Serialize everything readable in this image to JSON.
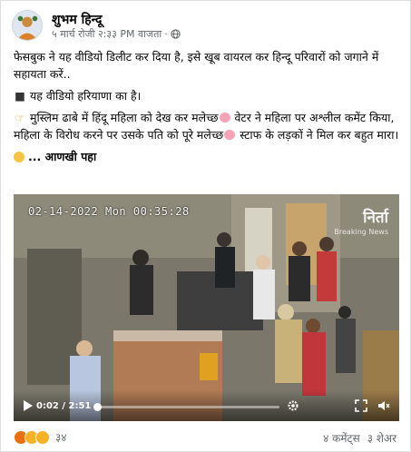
{
  "header": {
    "author": "शुभम हिन्दू",
    "timestamp": "५ मार्च रोजी २:३३ PM वाजता",
    "separator": "·",
    "privacy_icon": "globe-icon"
  },
  "post": {
    "line1": "फेसबुक ने यह वीडियो डिलीट कर दिया है, इसे खूब वायरल कर हिन्दू परिवारों को जगाने में सहायता करें..",
    "line2": "यह वीडियो हरियाणा का है।",
    "line3a": "मुस्लिम ढाबे में हिंदू महिला को देख कर मलेच्छ",
    "line3b": "वेटर ने महिला पर अश्लील कमेंट किया, महिला के विरोध करने पर उसके पति को पूरे मलेच्छ",
    "line3c": "स्टाफ के लड़कों ने मिल कर बहुत मारा।",
    "see_more": "... आणखी पहा"
  },
  "video": {
    "overlay_timestamp": "02-14-2022 Mon 00:35:28",
    "brand_name": "निर्ता",
    "brand_sub": "Breaking News",
    "current_time": "0:02",
    "duration": "2:51",
    "time_display": "0:02 / 2:51",
    "progress": 0.012
  },
  "footer": {
    "reactions": [
      "angry",
      "sad",
      "haha"
    ],
    "reaction_count": "३४",
    "comments": "४ कमेंट्स",
    "shares": "३ शेअर"
  }
}
